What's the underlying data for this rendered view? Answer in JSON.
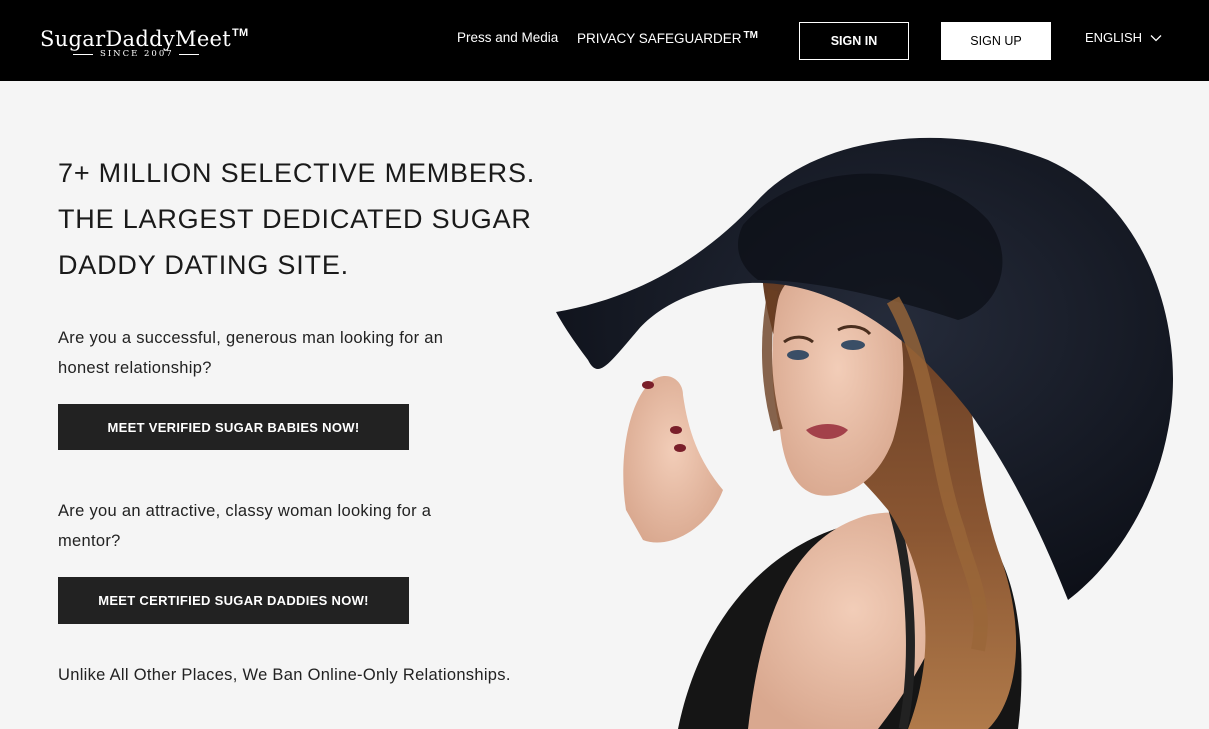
{
  "header": {
    "logo": {
      "name": "SugarDaddyMeet",
      "trademark": "TM",
      "since": "SINCE 2007"
    },
    "nav": {
      "press_label": "Press and Media",
      "privacy_label": "PRIVACY SAFEGUARDER",
      "privacy_tm": "TM"
    },
    "signin_label": "SIGN IN",
    "signup_label": "SIGN UP",
    "language": {
      "selected": "ENGLISH",
      "icon": "chevron-down-icon"
    }
  },
  "hero": {
    "headline_lines": [
      "7+ MILLION SELECTIVE MEMBERS.",
      "THE LARGEST DEDICATED SUGAR",
      "DADDY DATING SITE."
    ],
    "men": {
      "question": "Are you a successful, generous man looking for an honest relationship?",
      "cta_label": "MEET VERIFIED SUGAR BABIES NOW!"
    },
    "women": {
      "question": "Are you an attractive, classy woman looking for a mentor?",
      "cta_label": "MEET CERTIFIED SUGAR DADDIES NOW!"
    },
    "tagline": "Unlike All Other Places, We Ban Online-Only Relationships."
  },
  "colors": {
    "header_bg": "#000000",
    "page_bg": "#f5f5f5",
    "cta_bg": "#222222",
    "text": "#1a1a1a",
    "hat": "#141824",
    "hair": "#7a4a2a"
  }
}
